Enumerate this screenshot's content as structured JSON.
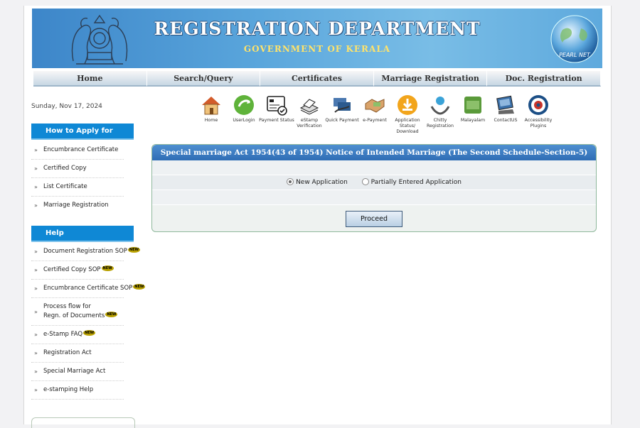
{
  "header": {
    "title": "REGISTRATION DEPARTMENT",
    "subtitle": "GOVERNMENT OF KERALA",
    "globe_text": "PEARL NET"
  },
  "nav": [
    "Home",
    "Search/Query",
    "Certificates",
    "Marriage Registration",
    "Doc. Registration"
  ],
  "date": "Sunday, Nov 17, 2024",
  "sidebar": {
    "apply_heading": "How to Apply for",
    "apply_items": [
      "Encumbrance Certificate",
      "Certified Copy",
      "List Certificate",
      "Marriage Registration"
    ],
    "help_heading": "Help",
    "help_items": [
      {
        "label": "Document Registration SOP",
        "new": true
      },
      {
        "label": "Certified Copy SOP",
        "new": true
      },
      {
        "label": "Encumbrance Certificate SOP",
        "new": true
      },
      {
        "label": "Process flow for",
        "label2": "Regn. of Documents",
        "new": true
      },
      {
        "label": "e-Stamp FAQ",
        "new": true
      },
      {
        "label": "Registration Act",
        "new": false
      },
      {
        "label": "Special Marriage Act",
        "new": false
      },
      {
        "label": "e-stamping Help",
        "new": false
      }
    ],
    "new_tag": "NEW"
  },
  "quick_icons": [
    {
      "label": "Home",
      "icon": "home-icon"
    },
    {
      "label": "UserLogin",
      "icon": "user-login-icon"
    },
    {
      "label": "Payment Status",
      "icon": "payment-status-icon"
    },
    {
      "label": "eStamp Verification",
      "icon": "estamp-icon"
    },
    {
      "label": "Quick Payment",
      "icon": "quick-payment-icon"
    },
    {
      "label": "e-Payment",
      "icon": "epayment-icon"
    },
    {
      "label": "Application Status/ Download",
      "icon": "download-icon"
    },
    {
      "label": "Chitty Registration",
      "icon": "chitty-icon"
    },
    {
      "label": "Malayalam",
      "icon": "malayalam-icon"
    },
    {
      "label": "ContactUS",
      "icon": "contact-icon"
    },
    {
      "label": "Accessibility Plugins",
      "icon": "accessibility-icon"
    }
  ],
  "panel": {
    "title": "Special marriage Act 1954(43 of 1954) Notice of Intended Marriage (The Second Schedule-Section-5)",
    "option_new": "New Application",
    "option_partial": "Partially Entered Application",
    "selected": "new",
    "proceed": "Proceed"
  },
  "colors": {
    "accent": "#0f88d5",
    "panel_title": "#2f6db5"
  }
}
